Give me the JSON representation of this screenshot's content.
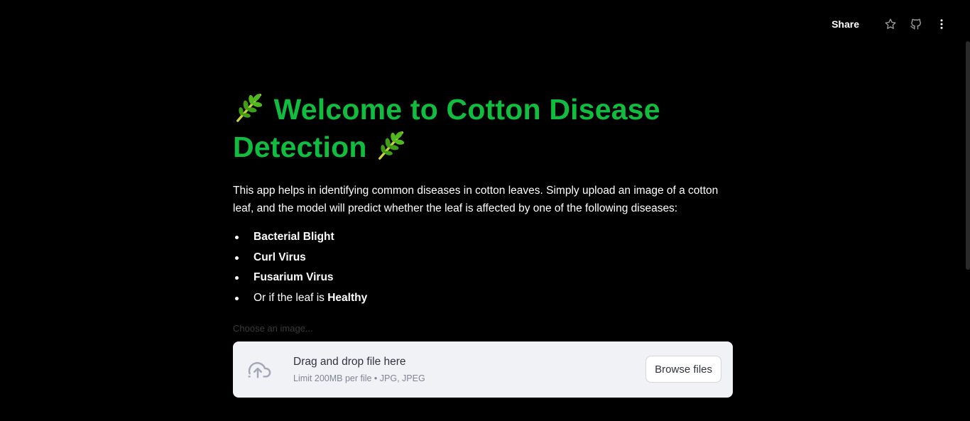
{
  "toolbar": {
    "share_label": "Share",
    "icons": [
      "star-icon",
      "github-icon",
      "more-vertical-icon"
    ]
  },
  "content": {
    "title_part1": "Welcome to Cotton Disease",
    "title_part2": "Detection",
    "title_icon": "herb-icon",
    "intro": "This app helps in identifying common diseases in cotton leaves. Simply upload an image of a cotton leaf, and the model will predict whether the leaf is affected by one of the following diseases:",
    "diseases": [
      "Bacterial Blight",
      "Curl Virus",
      "Fusarium Virus"
    ],
    "healthy_prefix": "Or if the leaf is ",
    "healthy_label": "Healthy"
  },
  "uploader": {
    "label": "Choose an image...",
    "drop_text": "Drag and drop file here",
    "limit_text": "Limit 200MB per file • JPG, JPEG",
    "browse_label": "Browse files",
    "icon": "cloud-upload-icon"
  },
  "colors": {
    "background": "#000000",
    "title_green": "#11bd3f",
    "dropzone_bg": "#f0f2f6"
  }
}
